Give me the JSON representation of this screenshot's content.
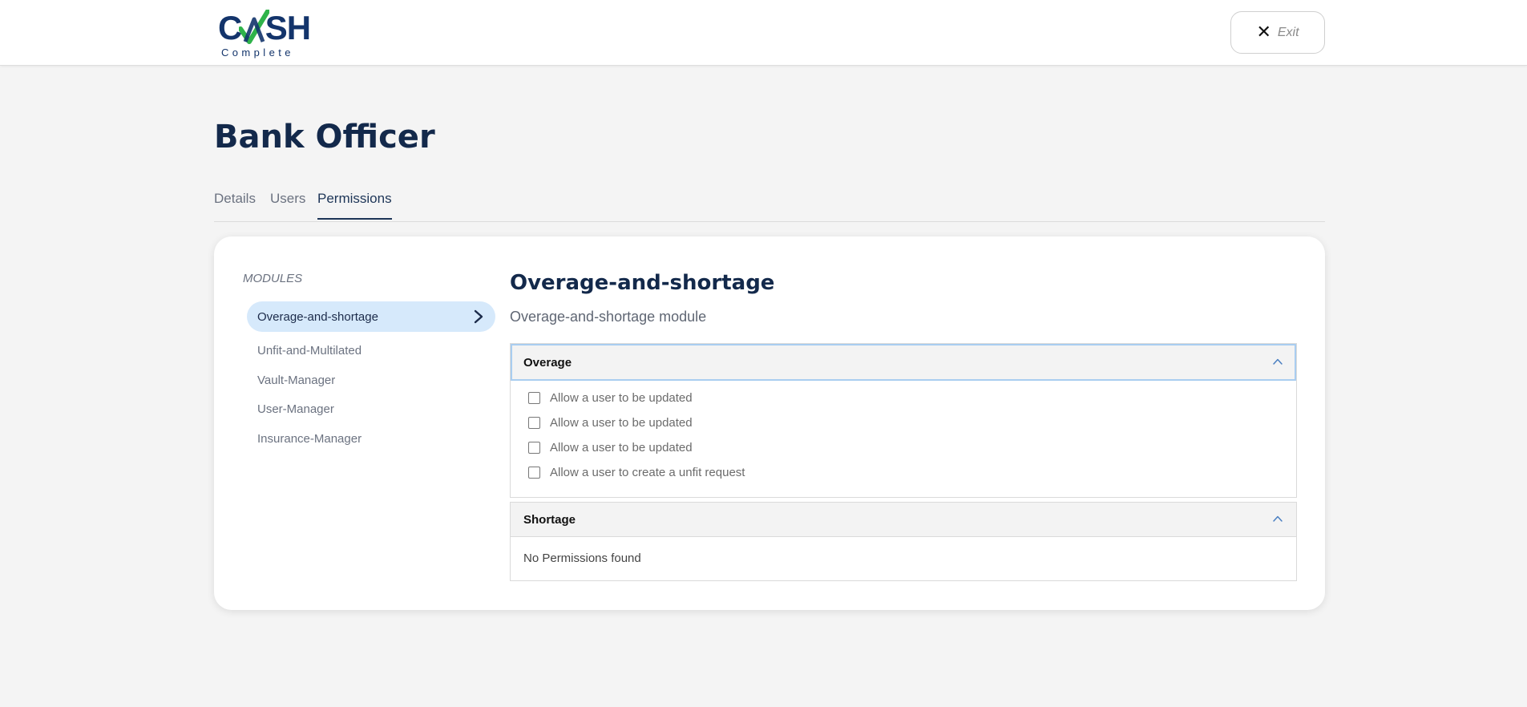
{
  "header": {
    "logo": {
      "word": "CASH",
      "sub": "Complete"
    },
    "exit_label": "Exit"
  },
  "page": {
    "title": "Bank Officer",
    "tabs": [
      {
        "label": "Details",
        "active": false
      },
      {
        "label": "Users",
        "active": false
      },
      {
        "label": "Permissions",
        "active": true
      }
    ]
  },
  "sidebar": {
    "heading": "MODULES",
    "items": [
      {
        "label": "Overage-and-shortage",
        "selected": true
      },
      {
        "label": "Unfit-and-Multilated",
        "selected": false
      },
      {
        "label": "Vault-Manager",
        "selected": false
      },
      {
        "label": "User-Manager",
        "selected": false
      },
      {
        "label": "Insurance-Manager",
        "selected": false
      }
    ]
  },
  "module": {
    "title": "Overage-and-shortage",
    "description": "Overage-and-shortage module",
    "sections": [
      {
        "name": "Overage",
        "expanded": true,
        "permissions": [
          {
            "label": "Allow a user to be updated",
            "checked": false
          },
          {
            "label": "Allow a user to be updated",
            "checked": false
          },
          {
            "label": "Allow a user to be updated",
            "checked": false
          },
          {
            "label": "Allow a user to create a unfit request",
            "checked": false
          }
        ]
      },
      {
        "name": "Shortage",
        "expanded": true,
        "empty_message": "No Permissions found"
      }
    ]
  },
  "colors": {
    "brand_navy": "#13346b",
    "brand_green": "#2fb34a",
    "selected_bg": "#d6e9fb",
    "page_bg": "#f4f4f4"
  },
  "icons": {
    "exit": "close-icon",
    "module_selected": "chevron-right-icon",
    "section_toggle": "chevron-up-icon"
  }
}
